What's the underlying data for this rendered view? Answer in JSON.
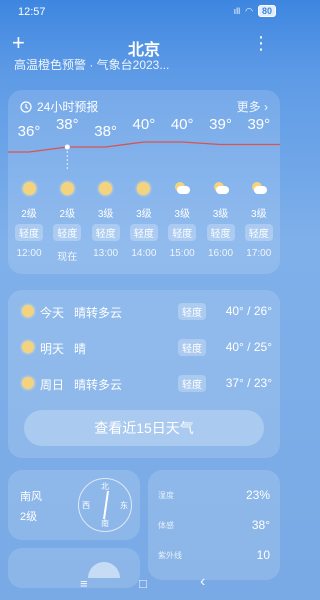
{
  "status_bar": {
    "time": "12:57",
    "battery": "80",
    "signal_glyph": "ıll",
    "wifi_glyph": "◠"
  },
  "header": {
    "city": "北京",
    "add_glyph": "+",
    "menu_glyph": "⋮"
  },
  "alert": {
    "text": "高温橙色预警 · 气象台2023..."
  },
  "hourly": {
    "title": "24小时预报",
    "more_label": "更多 ›",
    "items": [
      {
        "temp": "36°",
        "icon": "sun-icon",
        "wind": "2级",
        "aqi": "轻度",
        "time": "12:00"
      },
      {
        "temp": "38°",
        "icon": "sun-icon",
        "wind": "2级",
        "aqi": "轻度",
        "time": "现在"
      },
      {
        "temp": "38°",
        "icon": "sun-icon",
        "wind": "3级",
        "aqi": "轻度",
        "time": "13:00"
      },
      {
        "temp": "40°",
        "icon": "sun-icon",
        "wind": "3级",
        "aqi": "轻度",
        "time": "14:00"
      },
      {
        "temp": "40°",
        "icon": "partly-cloudy-icon",
        "wind": "3级",
        "aqi": "轻度",
        "time": "15:00"
      },
      {
        "temp": "39°",
        "icon": "partly-cloudy-icon",
        "wind": "3级",
        "aqi": "轻度",
        "time": "16:00"
      },
      {
        "temp": "39°",
        "icon": "partly-cloudy-icon",
        "wind": "3级",
        "aqi": "轻度",
        "time": "17:00"
      }
    ]
  },
  "daily": {
    "items": [
      {
        "day": "今天",
        "condition": "晴转多云",
        "aqi": "轻度",
        "range": "40° / 26°"
      },
      {
        "day": "明天",
        "condition": "晴",
        "aqi": "轻度",
        "range": "40° / 25°"
      },
      {
        "day": "周日",
        "condition": "晴转多云",
        "aqi": "轻度",
        "range": "37° / 23°"
      }
    ],
    "button_label": "查看近15日天气"
  },
  "wind": {
    "direction": "南风",
    "level": "2级",
    "compass": {
      "n": "北",
      "s": "南",
      "e": "东",
      "w": "西"
    }
  },
  "details": [
    {
      "label": "湿度",
      "value": "23%"
    },
    {
      "label": "体感",
      "value": "38°"
    },
    {
      "label": "紫外线",
      "value": "10"
    }
  ],
  "navbar": {
    "menu": "≡",
    "home": "□",
    "back": "‹"
  },
  "colors": {
    "temp_line": "#d9534f",
    "sun": "#f3d37d"
  }
}
